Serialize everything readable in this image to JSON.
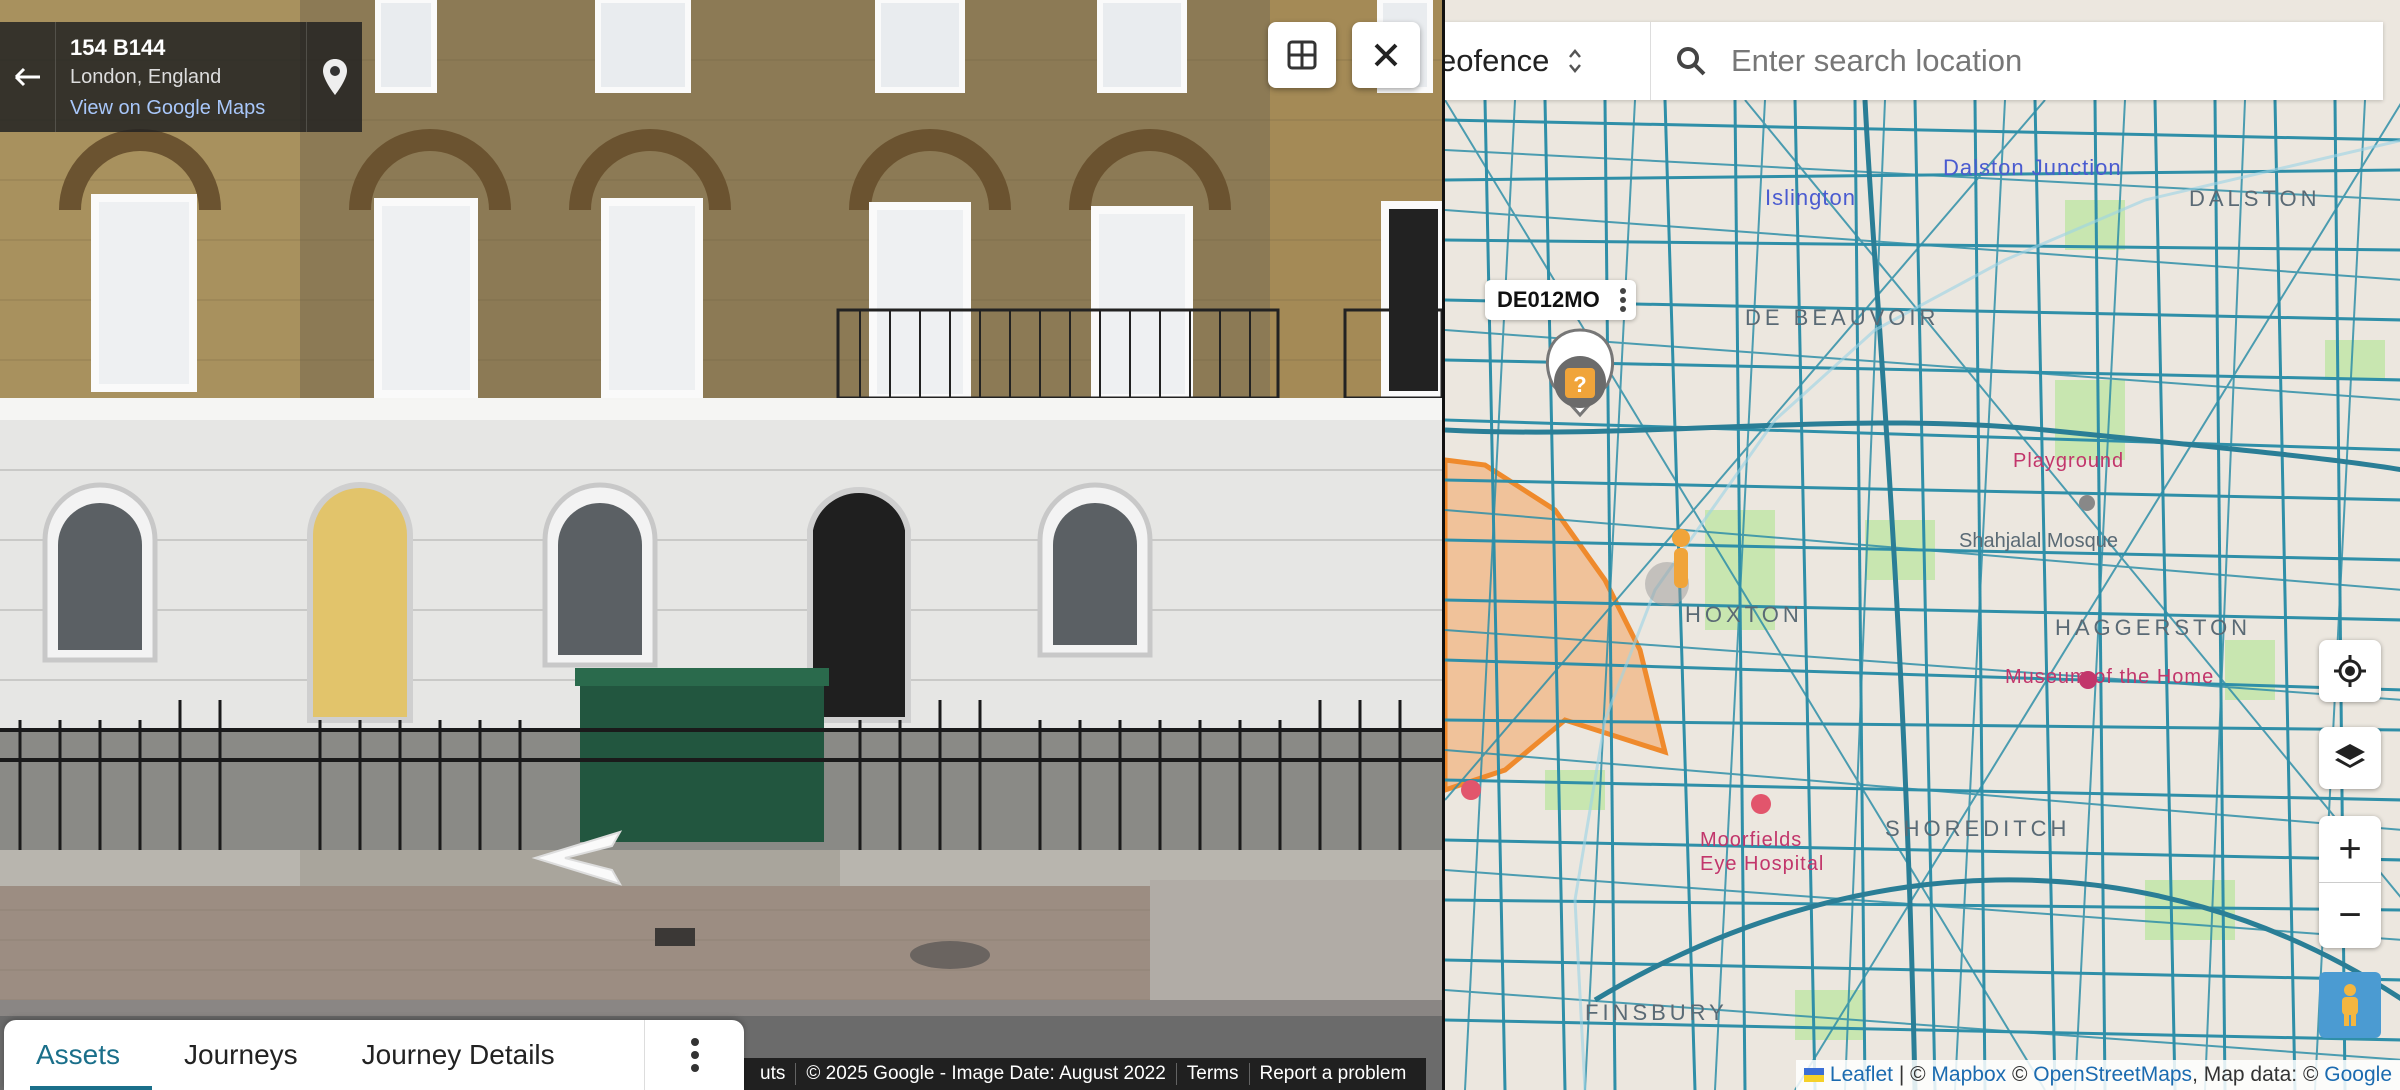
{
  "streetview": {
    "location_title": "154 B144",
    "location_subtitle": "London, England",
    "maps_link": "View on Google Maps",
    "footer": {
      "shortcuts_fragment": "uts",
      "copyright": "© 2025 Google - Image Date: August 2022",
      "terms": "Terms",
      "report": "Report a problem"
    }
  },
  "tabs": [
    {
      "label": "Assets",
      "active": true
    },
    {
      "label": "Journeys",
      "active": false
    },
    {
      "label": "Journey Details",
      "active": false
    }
  ],
  "map": {
    "geofence_label": "eofence",
    "search_placeholder": "Enter search location",
    "asset_id": "DE012MO",
    "asset_marker_glyph": "?",
    "areas": {
      "de_beauvoir": "DE BEAUVOIR",
      "dalston": "DALSTON",
      "hoxton": "HOXTON",
      "haggerston": "HAGGERSTON",
      "shoreditch": "SHOREDITCH",
      "finsbury": "FINSBURY",
      "islington": "Islington",
      "dalston_junction": "Dalston Junction"
    },
    "pois": {
      "moorfields": "Moorfields Eye Hospital",
      "mosque": "Shahjalal Mosque",
      "museum": "Museum of the Home",
      "playground": "Playground"
    },
    "controls": {
      "zoom_in": "+",
      "zoom_out": "−"
    },
    "attribution": {
      "leaflet": "Leaflet",
      "sep1": " | © ",
      "mapbox": "Mapbox",
      "sep2": " © ",
      "osm": "OpenStreetMaps",
      "tail": ", Map data: © ",
      "google": "Google"
    },
    "colors": {
      "road": "#2f8fa8",
      "geofence_fill": "#f2b27c",
      "geofence_stroke": "#ef8a2c",
      "park": "#c8e6b0",
      "marker": "#f0a43a"
    }
  }
}
